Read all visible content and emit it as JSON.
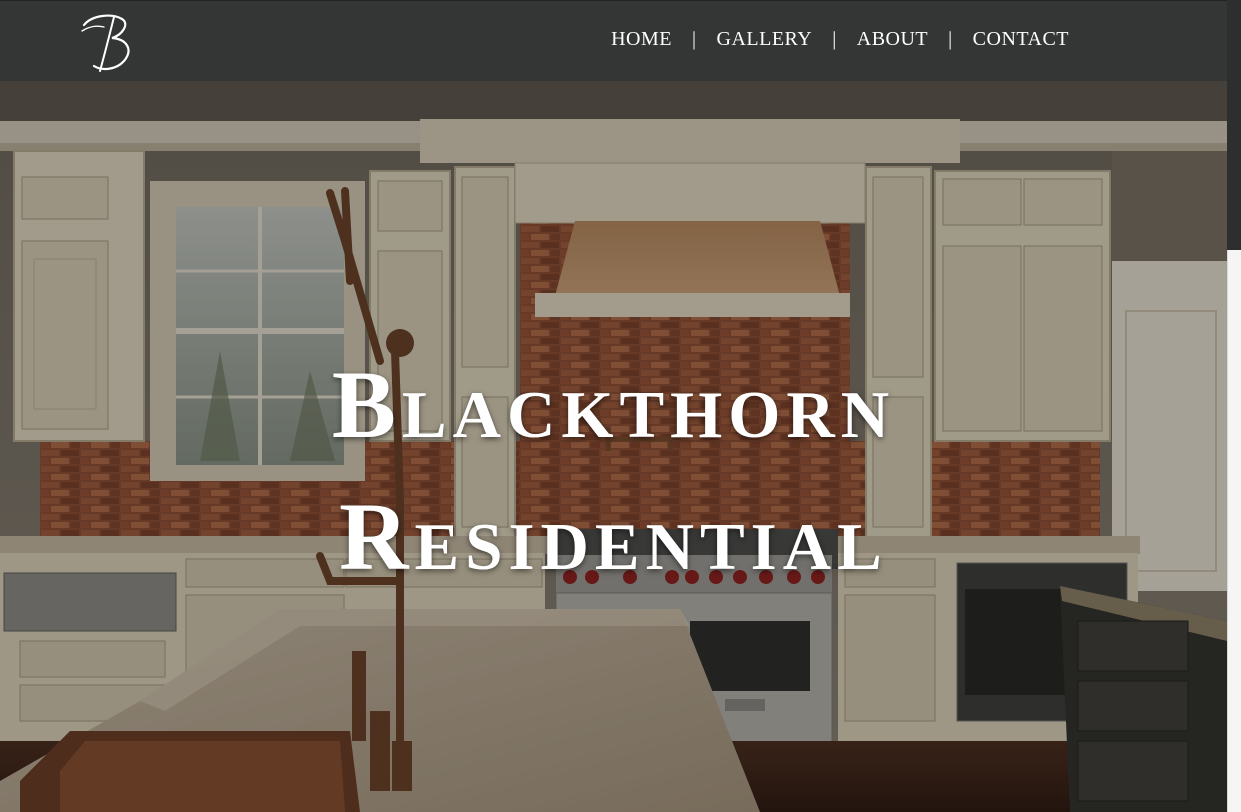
{
  "brand": {
    "logo_letter": "B"
  },
  "nav": {
    "items": [
      {
        "label": "HOME"
      },
      {
        "label": "GALLERY"
      },
      {
        "label": "ABOUT"
      },
      {
        "label": "CONTACT"
      }
    ],
    "separator": "|"
  },
  "hero": {
    "title_line1": "Blackthorn",
    "title_line2": "Residential",
    "image": "kitchen-interior-photo"
  },
  "colors": {
    "header_bg": "#343535",
    "text": "#ffffff",
    "page_bg": "#f3f3f1"
  }
}
